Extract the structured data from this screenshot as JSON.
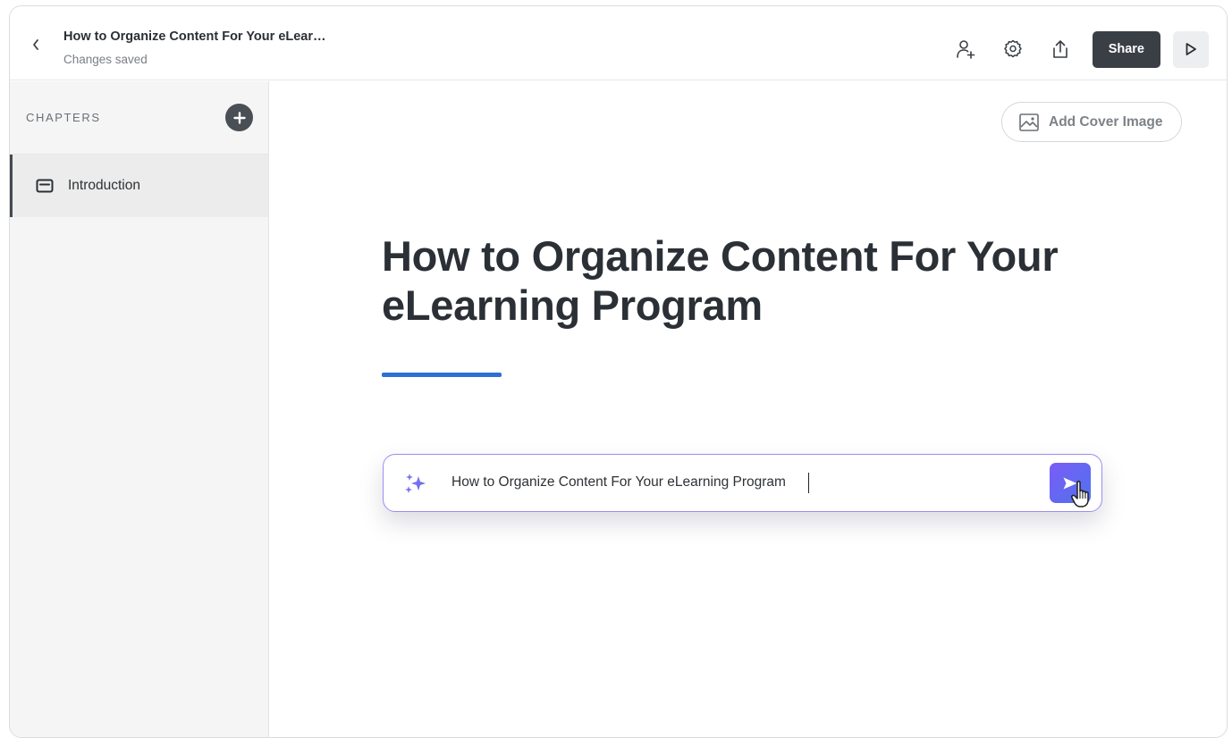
{
  "header": {
    "title": "How to Organize Content For Your eLear…",
    "status": "Changes saved",
    "share_label": "Share",
    "icons": [
      "back-chevron-icon",
      "add-collaborator-icon",
      "settings-gear-icon",
      "export-upload-icon",
      "play-icon"
    ]
  },
  "sidebar": {
    "section_label": "CHAPTERS",
    "items": [
      {
        "label": "Introduction",
        "icon": "chapter-card-icon",
        "selected": true
      }
    ]
  },
  "main": {
    "cover_button_label": "Add Cover Image",
    "heading": "How to Organize Content For Your eLearning Program",
    "prompt": {
      "value": "How to Organize Content For Your eLearning Program",
      "icon": "ai-sparkle-icon",
      "send_icon": "send-arrow-icon"
    }
  },
  "colors": {
    "share_button_bg": "#3a3f45",
    "heading_underline": "#2d6fd6",
    "prompt_border": "#9b8ef0",
    "send_gradient_start": "#7a5cf5",
    "send_gradient_end": "#4f73ee"
  }
}
